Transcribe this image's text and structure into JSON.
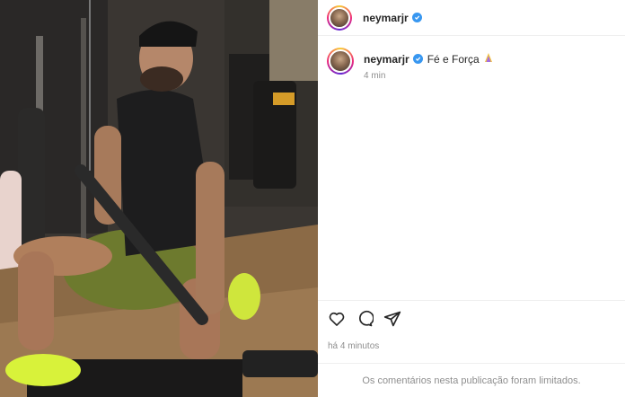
{
  "post": {
    "username": "neymarjr",
    "caption_text": "Fé e Força",
    "caption_time": "4 min",
    "posted_ago": "há 4 minutos",
    "comments_notice": "Os comentários nesta publicação foram limitados."
  },
  "icons": {
    "like": "heart-icon",
    "comment": "comment-icon",
    "share": "share-icon",
    "verified": "verified-badge-icon",
    "caption_emoji": "praying-hands-emoji"
  },
  "colors": {
    "verified_blue": "#3897f0",
    "muted_text": "#8e8e8e",
    "divider": "#efefef"
  }
}
